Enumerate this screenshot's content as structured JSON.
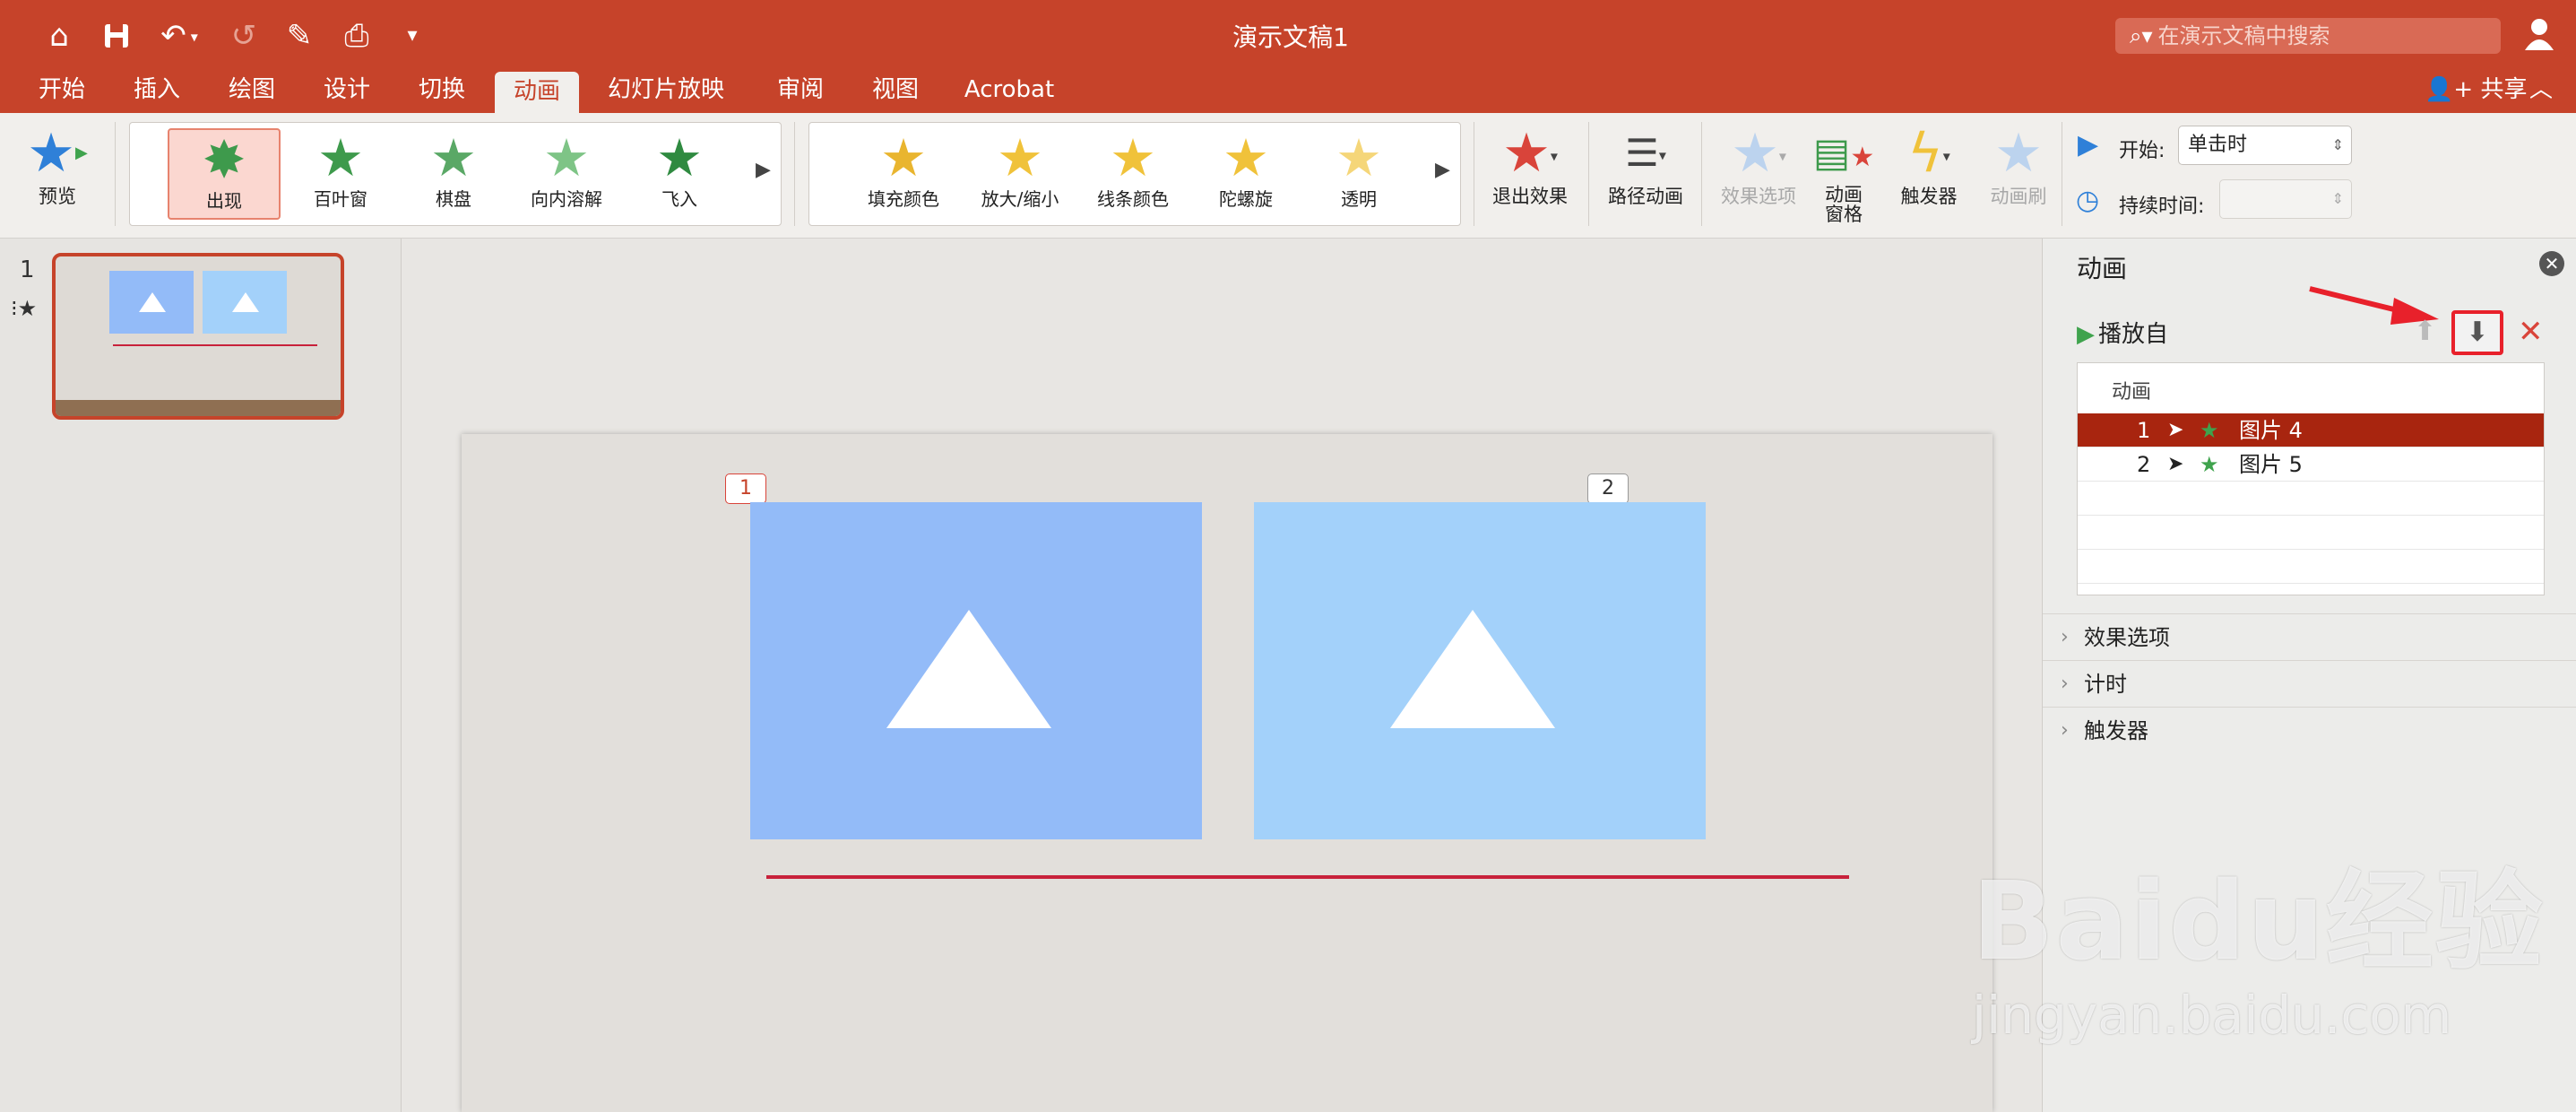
{
  "window": {
    "title": "演示文稿1"
  },
  "search": {
    "placeholder": "在演示文稿中搜索"
  },
  "tabs": [
    {
      "label": "开始"
    },
    {
      "label": "插入"
    },
    {
      "label": "绘图"
    },
    {
      "label": "设计"
    },
    {
      "label": "切换"
    },
    {
      "label": "动画"
    },
    {
      "label": "幻灯片放映"
    },
    {
      "label": "审阅"
    },
    {
      "label": "视图"
    },
    {
      "label": "Acrobat"
    }
  ],
  "active_tab": "动画",
  "share_label": "共享",
  "ribbon": {
    "preview_label": "预览",
    "entrance_effects": [
      {
        "label": "出现",
        "selected": true
      },
      {
        "label": "百叶窗"
      },
      {
        "label": "棋盘"
      },
      {
        "label": "向内溶解"
      },
      {
        "label": "飞入"
      }
    ],
    "emphasis_effects": [
      {
        "label": "填充颜色"
      },
      {
        "label": "放大/缩小"
      },
      {
        "label": "线条颜色"
      },
      {
        "label": "陀螺旋"
      },
      {
        "label": "透明"
      }
    ],
    "exit_effect_label": "退出效果",
    "path_animation_label": "路径动画",
    "effect_options_label": "效果选项",
    "animation_pane_label_1": "动画",
    "animation_pane_label_2": "窗格",
    "trigger_label": "触发器",
    "animation_painter_label": "动画刷",
    "start_label": "开始:",
    "start_value": "单击时",
    "duration_label": "持续时间:",
    "duration_value": ""
  },
  "thumbnails": [
    {
      "number": "1"
    }
  ],
  "slide": {
    "tags": [
      "1",
      "2"
    ],
    "pic1_color": "#93bbf8",
    "pic2_color": "#a3d1fa",
    "line_color": "#c8213b"
  },
  "pane": {
    "title": "动画",
    "play_label": "播放自",
    "list_header": "动画",
    "items": [
      {
        "num": "1",
        "name": "图片 4",
        "selected": true
      },
      {
        "num": "2",
        "name": "图片 5"
      }
    ],
    "sections": [
      {
        "label": "效果选项"
      },
      {
        "label": "计时"
      },
      {
        "label": "触发器"
      }
    ]
  },
  "watermark": {
    "logo": "Baidu经验",
    "url": "jingyan.baidu.com"
  },
  "colors": {
    "accent": "#c6432a",
    "selected_row": "#a8250f",
    "highlight_box": "#e8212b"
  }
}
